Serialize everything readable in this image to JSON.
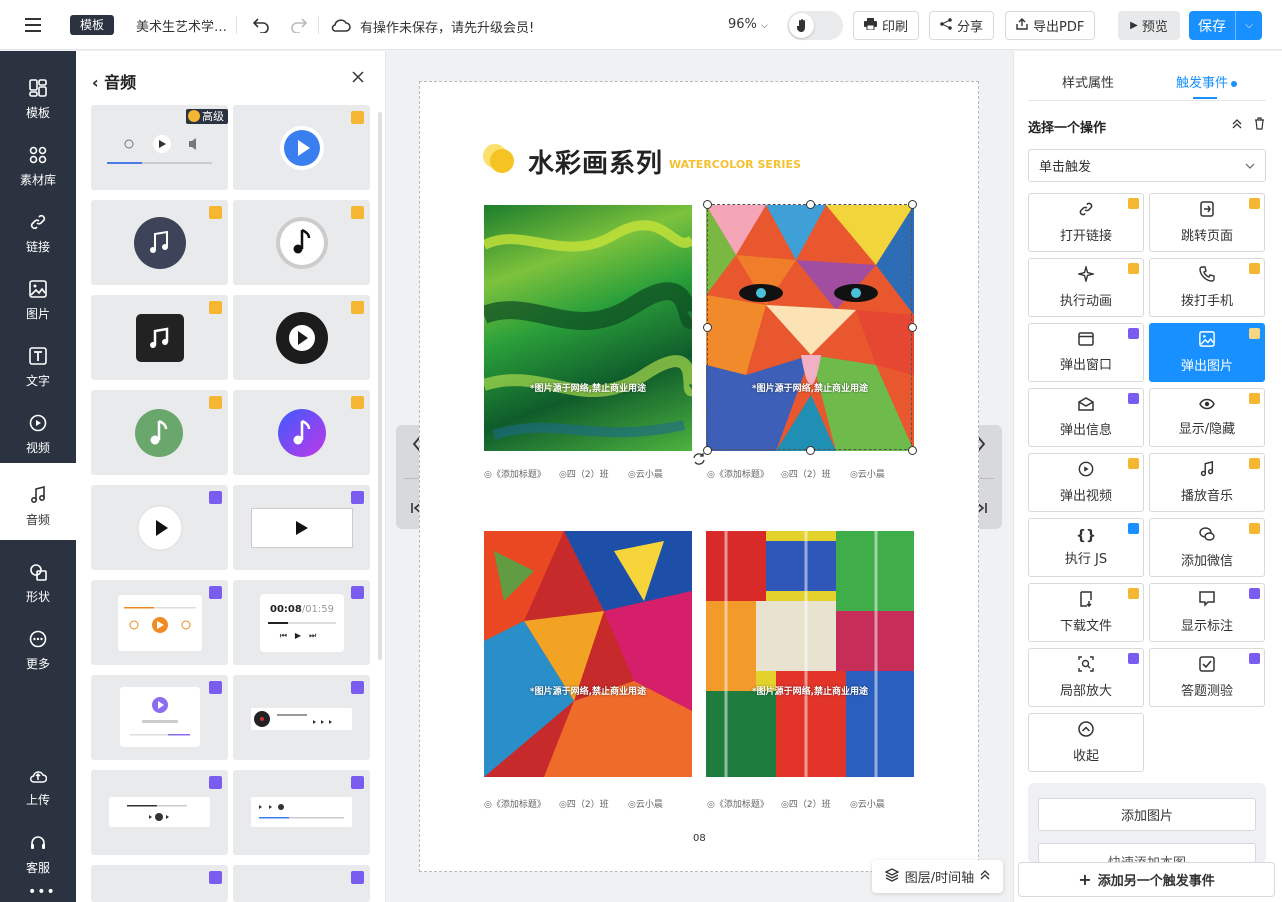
{
  "topbar": {
    "template_badge": "模板",
    "doc_title": "美术生艺术学…",
    "save_warning": "有操作未保存，请先升级会员!",
    "zoom": "96%",
    "print_label": "印刷",
    "share_label": "分享",
    "export_label": "导出PDF",
    "preview_label": "预览",
    "save_label": "保存"
  },
  "left_nav": [
    {
      "label": "模板",
      "icon": "template-icon"
    },
    {
      "label": "素材库",
      "icon": "grid-icon"
    },
    {
      "label": "链接",
      "icon": "link-icon"
    },
    {
      "label": "图片",
      "icon": "image-icon"
    },
    {
      "label": "文字",
      "icon": "text-icon"
    },
    {
      "label": "视频",
      "icon": "video-icon"
    },
    {
      "label": "音频",
      "icon": "music-icon"
    },
    {
      "label": "形状",
      "icon": "shape-icon"
    },
    {
      "label": "更多",
      "icon": "more-icon"
    },
    {
      "label": "上传",
      "icon": "upload-icon"
    },
    {
      "label": "客服",
      "icon": "headset-icon"
    }
  ],
  "audio_panel": {
    "title": "音频",
    "premium_label": "高级",
    "player_time_a": "00:08",
    "player_time_b": "/01:59"
  },
  "page": {
    "title": "水彩画系列",
    "subtitle": "WATERCOLOR SERIES",
    "watermark": "*图片源于网络,禁止商业用途",
    "caption_title": "◎《添加标题》",
    "caption_class": "◎四（2）班",
    "caption_name": "◎云小晨",
    "page_number": "08"
  },
  "layer_button": "图层/时间轴",
  "right_panel": {
    "tab_style": "样式属性",
    "tab_trigger": "触发事件",
    "select_action_title": "选择一个操作",
    "trigger_select": "单击触发",
    "actions": [
      {
        "label": "打开链接",
        "icon": "link-icon",
        "badge": "gold"
      },
      {
        "label": "跳转页面",
        "icon": "jump-page-icon",
        "badge": "gold"
      },
      {
        "label": "执行动画",
        "icon": "sparkle-icon",
        "badge": "gold"
      },
      {
        "label": "拨打手机",
        "icon": "phone-icon",
        "badge": "gold"
      },
      {
        "label": "弹出窗口",
        "icon": "window-icon",
        "badge": "purple"
      },
      {
        "label": "弹出图片",
        "icon": "image-icon",
        "badge": "gold"
      },
      {
        "label": "弹出信息",
        "icon": "envelope-icon",
        "badge": "purple"
      },
      {
        "label": "显示/隐藏",
        "icon": "eye-icon",
        "badge": "gold"
      },
      {
        "label": "弹出视频",
        "icon": "video-icon",
        "badge": "gold"
      },
      {
        "label": "播放音乐",
        "icon": "music-icon",
        "badge": "gold"
      },
      {
        "label": "执行 JS",
        "icon": "code-icon",
        "badge": "blue"
      },
      {
        "label": "添加微信",
        "icon": "wechat-icon",
        "badge": "gold"
      },
      {
        "label": "下载文件",
        "icon": "download-icon",
        "badge": "gold"
      },
      {
        "label": "显示标注",
        "icon": "comment-icon",
        "badge": "purple"
      },
      {
        "label": "局部放大",
        "icon": "zoom-icon",
        "badge": "purple"
      },
      {
        "label": "答题测验",
        "icon": "quiz-icon",
        "badge": "purple"
      },
      {
        "label": "收起",
        "icon": "collapse-icon",
        "badge": ""
      }
    ],
    "add_image_label": "添加图片",
    "quick_add_label": "快速添加本图",
    "add_event_label": "添加另一个触发事件"
  },
  "colors": {
    "accent": "#1890ff",
    "nav_bg": "#2b3340",
    "gold": "#f5b632",
    "purple": "#7b5cf0"
  }
}
